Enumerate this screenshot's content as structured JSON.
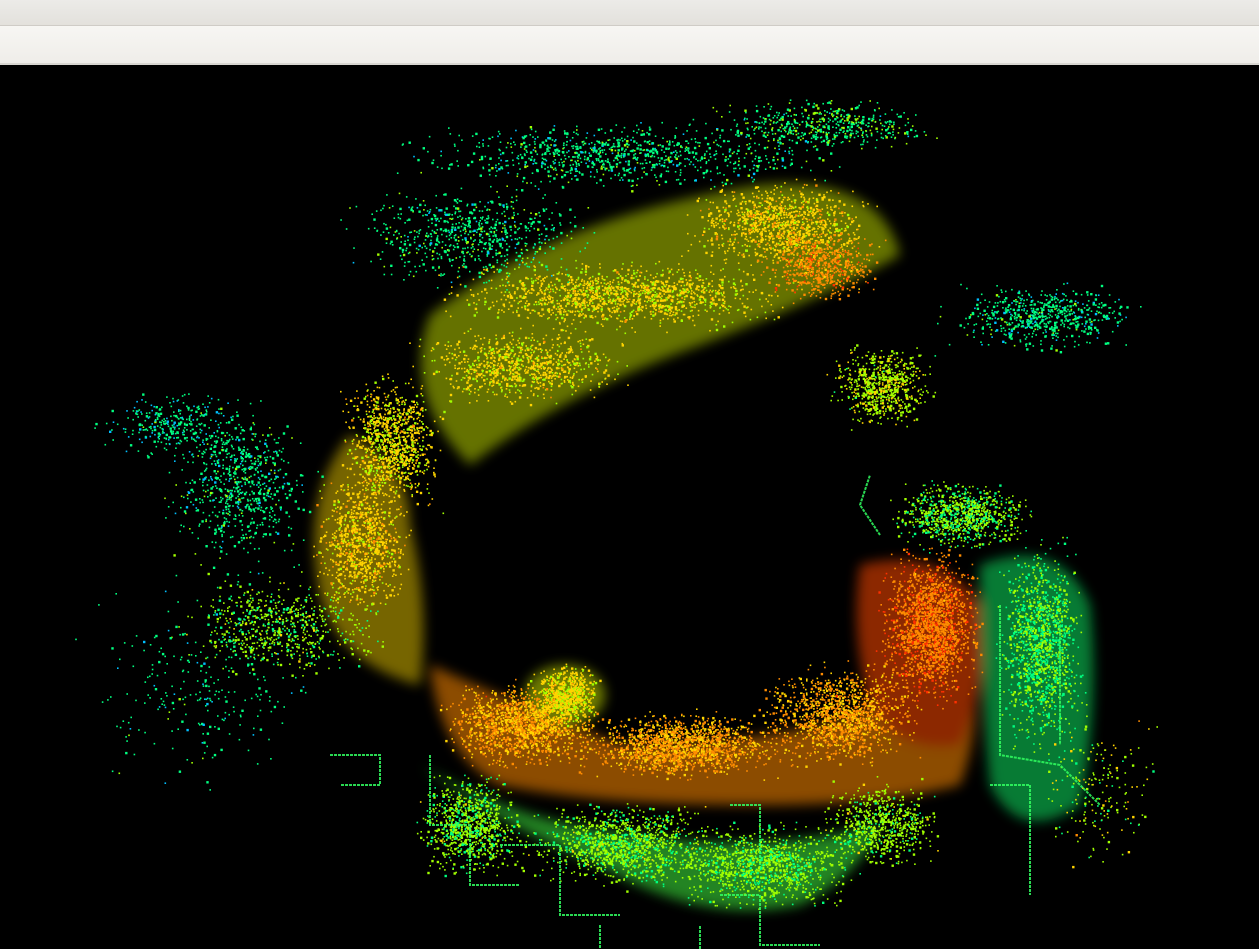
{
  "window": {
    "title": "",
    "toolbar_label": ""
  },
  "viewport": {
    "content": "point-cloud-map",
    "background_color": "#000000",
    "colormap": [
      "#00bfff",
      "#00ff80",
      "#a0ff00",
      "#ffd400",
      "#ff8c00",
      "#ff3000"
    ]
  }
}
